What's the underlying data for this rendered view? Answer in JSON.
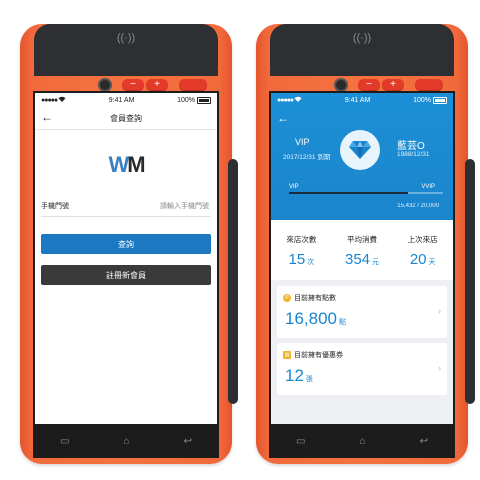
{
  "left_device": {
    "status": {
      "time": "9:41 AM",
      "battery": "100%"
    },
    "nfc_symbol": "((·))",
    "hw_buttons": {
      "minus": "−",
      "plus": "+"
    },
    "title": "會員查詢",
    "logo": {
      "w": "W",
      "m": "M"
    },
    "phone_field": {
      "label": "手機門號",
      "placeholder": "請輸入手機門號",
      "value": ""
    },
    "query_button": "查詢",
    "register_button": "註冊新會員"
  },
  "right_device": {
    "status": {
      "time": "9:41 AM",
      "battery": "100%"
    },
    "nfc_symbol": "((·))",
    "hw_buttons": {
      "minus": "−",
      "plus": "+"
    },
    "membership": {
      "title": "VIP",
      "expiry": "2017/12/31 到期",
      "name": "藍芸O",
      "birthday": "1988/12/31",
      "level_current": "VIP",
      "level_next": "VVIP",
      "progress_text": "15,432 / 20,000",
      "progress_fraction": 0.7716
    },
    "stats": [
      {
        "label": "來店次數",
        "value": "15",
        "unit": "次"
      },
      {
        "label": "平均消費",
        "value": "354",
        "unit": "元"
      },
      {
        "label": "上次來店",
        "value": "20",
        "unit": "天"
      }
    ],
    "points_card": {
      "title": "目前擁有點數",
      "value": "16,800",
      "unit": "點"
    },
    "coupons_card": {
      "title": "目前擁有優惠券",
      "value": "12",
      "unit": "張"
    }
  },
  "colors": {
    "device_orange": "#f4733f",
    "accent_blue": "#1a85cc",
    "query_blue": "#1b78c2",
    "register_dark": "#3a3a3a",
    "badge_yellow": "#f0b52d"
  },
  "icons": [
    "nfc-icon",
    "camera-icon",
    "back-arrow-icon",
    "wifi-icon",
    "battery-icon",
    "diamond-icon",
    "points-icon",
    "coupon-icon",
    "chevron-right-icon",
    "nav-recent-icon",
    "nav-home-icon",
    "nav-back-icon"
  ]
}
